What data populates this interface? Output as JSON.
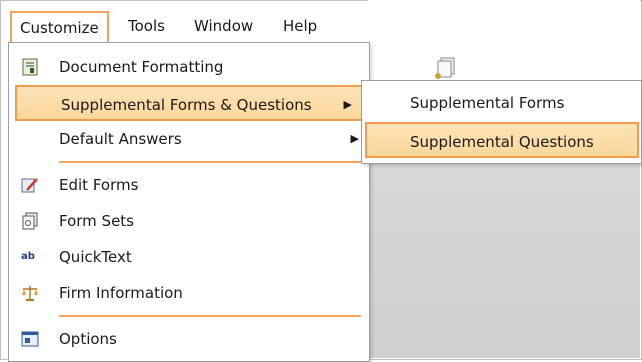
{
  "menubar": {
    "customize": "Customize",
    "tools": "Tools",
    "window": "Window",
    "help": "Help"
  },
  "menu": {
    "document_formatting": "Document Formatting",
    "supplemental": "Supplemental Forms & Questions",
    "default_answers": "Default Answers",
    "edit_forms": "Edit Forms",
    "form_sets": "Form Sets",
    "quicktext": "QuickText",
    "firm_information": "Firm Information",
    "options": "Options"
  },
  "submenu": {
    "supplemental_forms": "Supplemental Forms",
    "supplemental_questions": "Supplemental Questions"
  },
  "icons": {
    "document_formatting": "document-formatting-icon",
    "edit_forms": "edit-pencil-icon",
    "form_sets": "form-sets-icon",
    "quicktext": "quicktext-icon",
    "firm_information": "scales-icon",
    "options": "options-window-icon",
    "submenu_arrow": "arrow-right-icon"
  },
  "colors": {
    "highlight_border": "#f39a4f",
    "highlight_fill": "#fbd79a"
  },
  "quicktext_glyph": "ab"
}
